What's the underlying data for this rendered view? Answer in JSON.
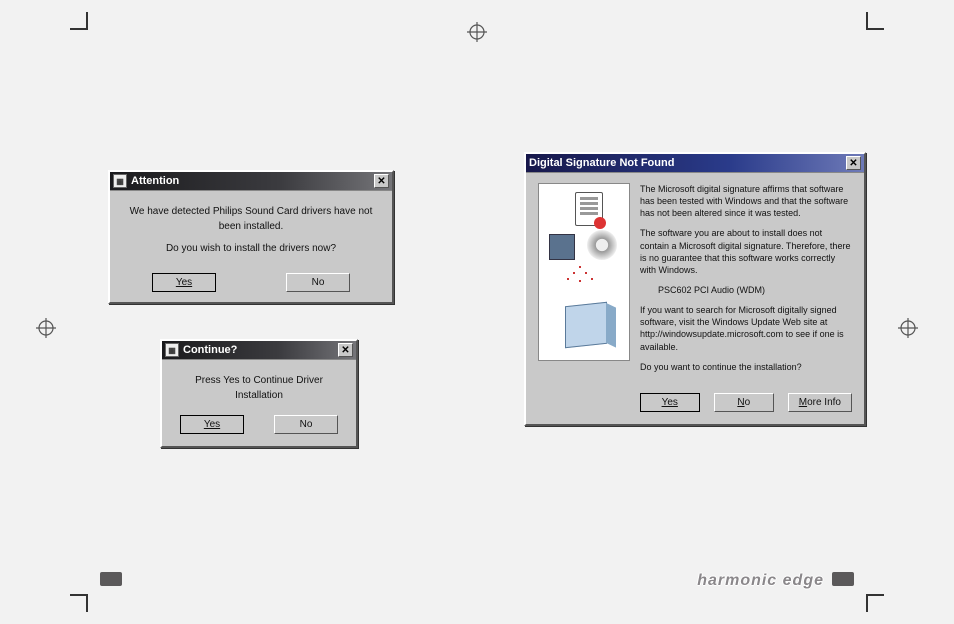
{
  "brand": "harmonic edge",
  "attention": {
    "title": "Attention",
    "body1": "We have detected Philips Sound Card drivers have not been installed.",
    "body2": "Do you wish to install the drivers now?",
    "yes": "Yes",
    "no": "No"
  },
  "continue": {
    "title": "Continue?",
    "body": "Press Yes to Continue Driver Installation",
    "yes": "Yes",
    "no": "No"
  },
  "signature": {
    "title": "Digital Signature Not Found",
    "para1": "The Microsoft digital signature affirms that software has been tested with Windows and that the software has not been altered since it was tested.",
    "para2": "The software you are about to install does not contain a Microsoft digital signature. Therefore, there is no guarantee that this software works correctly with Windows.",
    "device": "PSC602 PCI Audio (WDM)",
    "para3": "If you want to search for Microsoft digitally signed software, visit the Windows Update Web site at http://windowsupdate.microsoft.com to see if one is available.",
    "prompt": "Do you want to continue the installation?",
    "yes": "Yes",
    "no": "No",
    "more": "More Info"
  }
}
